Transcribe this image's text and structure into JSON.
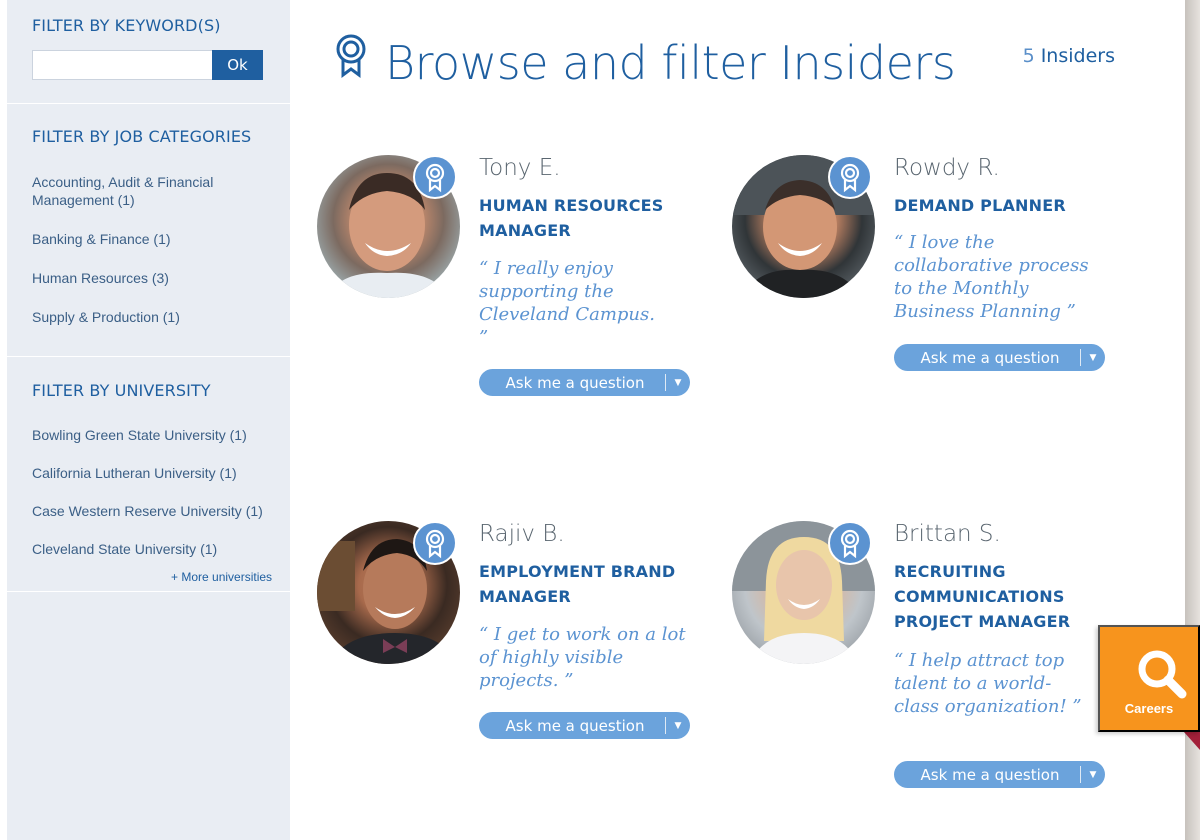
{
  "sidebar": {
    "keyword_title": "FILTER BY KEYWORD(S)",
    "keyword_value": "",
    "ok_label": "Ok",
    "categories_title": "FILTER BY JOB CATEGORIES",
    "categories": [
      {
        "label": "Accounting, Audit & Financial Management (1)"
      },
      {
        "label": "Banking & Finance (1)"
      },
      {
        "label": "Human Resources (3)"
      },
      {
        "label": "Supply & Production (1)"
      }
    ],
    "university_title": "FILTER BY UNIVERSITY",
    "universities": [
      {
        "label": "Bowling Green State University (1)"
      },
      {
        "label": "California Lutheran University (1)"
      },
      {
        "label": "Case Western Reserve University (1)"
      },
      {
        "label": "Cleveland State University (1)"
      }
    ],
    "more_universities": "+ More universities"
  },
  "header": {
    "title": "Browse and filter Insiders",
    "count": "5",
    "count_label": "Insiders"
  },
  "insiders": [
    {
      "name": "Tony E.",
      "role": "HUMAN RESOURCES MANAGER",
      "quote": "“ I really enjoy supporting the Cleveland Campus. ”",
      "button": "Ask me a question"
    },
    {
      "name": "Rowdy R.",
      "role": "DEMAND PLANNER",
      "quote": "“ I love the collaborative process to the Monthly Business Planning ”",
      "button": "Ask me a question"
    },
    {
      "name": "Rajiv B.",
      "role": "EMPLOYMENT BRAND MANAGER",
      "quote": "“ I get to work on a lot of highly visible projects. ”",
      "button": "Ask me a question"
    },
    {
      "name": "Brittan S.",
      "role": "RECRUITING COMMUNICATIONS PROJECT MANAGER",
      "quote": "“ I help attract top talent to a world-class organization! ”",
      "button": "Ask me a question"
    }
  ],
  "careers": {
    "label": "Careers"
  },
  "colors": {
    "brand_blue": "#1f5fa0",
    "light_blue": "#6ba3dc",
    "orange": "#f7941d",
    "sidebar_bg": "#e9edf3"
  }
}
